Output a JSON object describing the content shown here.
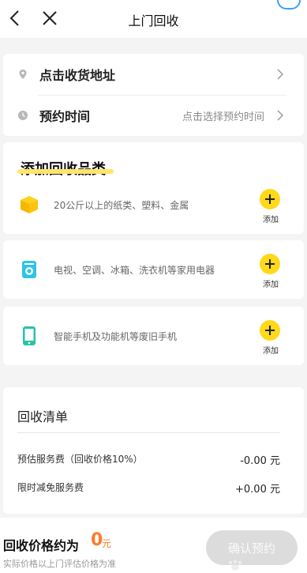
{
  "header": {
    "title": "上门回收",
    "back_icon": "chevron-left-icon",
    "close_icon": "close-icon"
  },
  "address_card": {
    "address_label": "点击收货地址",
    "time_label": "预约时间",
    "time_hint": "点击选择预约时间"
  },
  "categories": {
    "title": "添加回收品类",
    "items": [
      {
        "text": "20公斤以上的纸类、塑料、金属",
        "add_label": "添加",
        "icon": "box-icon"
      },
      {
        "text": "电视、空调、冰箱、洗衣机等家用电器",
        "add_label": "添加",
        "icon": "appliance-icon"
      },
      {
        "text": "智能手机及功能机等废旧手机",
        "add_label": "添加",
        "icon": "phone-icon"
      }
    ]
  },
  "recycle_list": {
    "title": "回收清单",
    "fees": [
      {
        "label": "预估服务费（回收价格10%）",
        "value": "-0.00 元"
      },
      {
        "label": "限时减免服务费",
        "value": "+0.00 元"
      }
    ]
  },
  "bottom_bar": {
    "price_label": "回收价格约为",
    "price_value": "0",
    "price_unit": "元",
    "note": "实际价格以上门评估价格为准",
    "confirm_label": "确认预约"
  },
  "colors": {
    "accent_yellow": "#ffd91a",
    "price_orange": "#ff7a2e",
    "disabled_button": "#dcdcdc",
    "background": "#f4f4f4"
  }
}
